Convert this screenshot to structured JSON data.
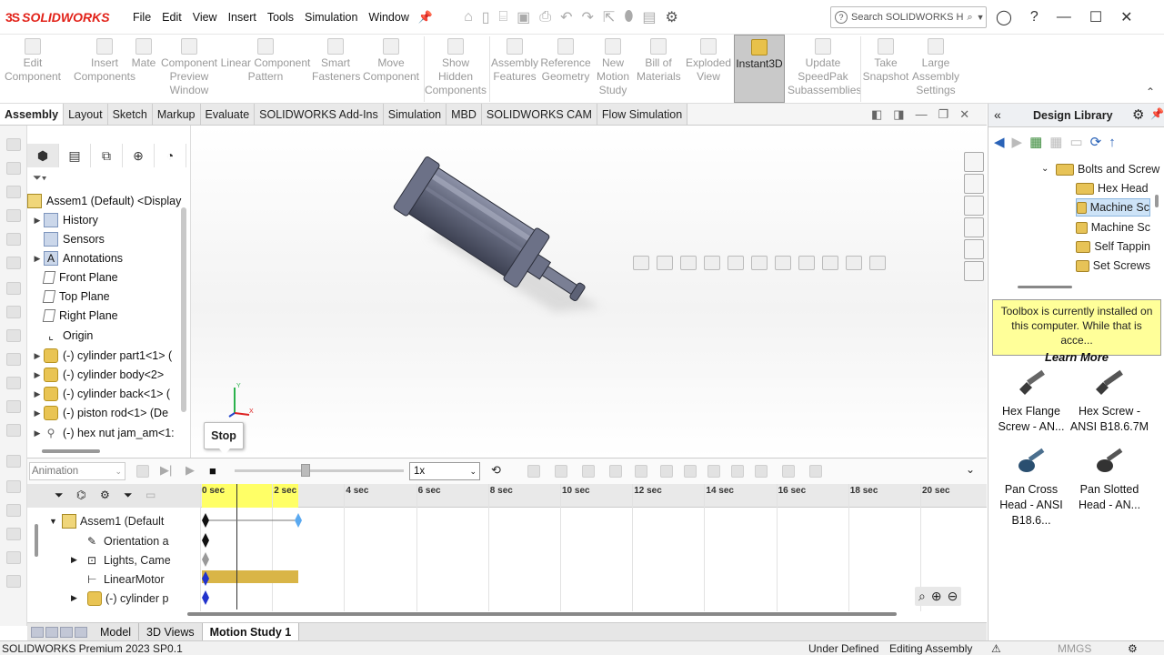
{
  "app": {
    "brand_ds": "3S",
    "brand_name": "SOLIDWORKS",
    "menus": [
      "File",
      "Edit",
      "View",
      "Insert",
      "Tools",
      "Simulation",
      "Window"
    ],
    "search_placeholder": "Search SOLIDWORKS H"
  },
  "commands": [
    {
      "label": "Edit\nComponent"
    },
    {
      "label": "Insert\nComponents"
    },
    {
      "label": "Mate"
    },
    {
      "label": "Component\nPreview\nWindow"
    },
    {
      "label": "Linear Component\nPattern"
    },
    {
      "label": "Smart\nFasteners"
    },
    {
      "label": "Move\nComponent"
    },
    {
      "label": "Show\nHidden\nComponents"
    },
    {
      "label": "Assembly\nFeatures"
    },
    {
      "label": "Reference\nGeometry"
    },
    {
      "label": "New\nMotion\nStudy"
    },
    {
      "label": "Bill of\nMaterials"
    },
    {
      "label": "Exploded\nView"
    },
    {
      "label": "Instant3D"
    },
    {
      "label": "Update\nSpeedPak\nSubassemblies"
    },
    {
      "label": "Take\nSnapshot"
    },
    {
      "label": "Large\nAssembly\nSettings"
    }
  ],
  "tabs": [
    "Assembly",
    "Layout",
    "Sketch",
    "Markup",
    "Evaluate",
    "SOLIDWORKS Add-Ins",
    "Simulation",
    "MBD",
    "SOLIDWORKS CAM",
    "Flow Simulation"
  ],
  "tree": {
    "root": "Assem1 (Default) <Display",
    "items": [
      {
        "label": "History"
      },
      {
        "label": "Sensors"
      },
      {
        "label": "Annotations"
      },
      {
        "label": "Front Plane"
      },
      {
        "label": "Top Plane"
      },
      {
        "label": "Right Plane"
      },
      {
        "label": "Origin"
      },
      {
        "label": "(-) cylinder part1<1> ("
      },
      {
        "label": "(-) cylinder  body<2>"
      },
      {
        "label": "(-) cylinder  back<1> ("
      },
      {
        "label": "(-) piston rod<1> (De"
      },
      {
        "label": "(-) hex nut jam_am<1:"
      }
    ]
  },
  "graphics": {
    "tooltip": "Stop"
  },
  "design_library": {
    "title": "Design Library",
    "folders": [
      "Bolts and Screw",
      "Hex Head",
      "Machine Sc",
      "Machine Sc",
      "Self Tappin",
      "Set Screws"
    ],
    "tip_text": "Toolbox is currently installed on this computer. While that is acce...",
    "tip_link": "Learn More",
    "items": [
      {
        "label": "Hex Flange Screw - AN..."
      },
      {
        "label": "Hex Screw - ANSI B18.6.7M"
      },
      {
        "label": "Pan Cross Head - ANSI B18.6..."
      },
      {
        "label": "Pan Slotted Head - AN..."
      }
    ]
  },
  "motion": {
    "study_type": "Animation",
    "speed": "1x",
    "ticks": [
      "0 sec",
      "2 sec",
      "4 sec",
      "6 sec",
      "8 sec",
      "10 sec",
      "12 sec",
      "14 sec",
      "16 sec",
      "18 sec",
      "20 sec"
    ],
    "tree": [
      "Assem1 (Default",
      "Orientation a",
      "Lights, Came",
      "LinearMotor",
      "(-) cylinder p"
    ]
  },
  "bottom_tabs": [
    "Model",
    "3D Views",
    "Motion Study 1"
  ],
  "status": {
    "version": "SOLIDWORKS Premium 2023 SP0.1",
    "state": "Under Defined",
    "mode": "Editing Assembly",
    "units": "MMGS"
  }
}
